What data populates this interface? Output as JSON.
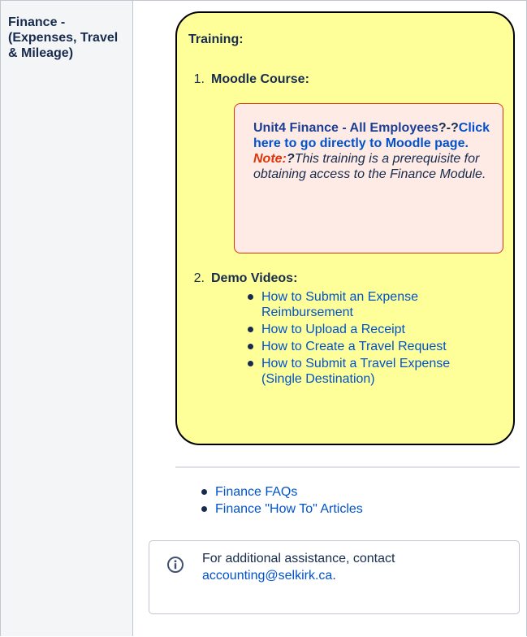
{
  "row_header": "Finance - (Expenses, Travel & Mileage)",
  "training": {
    "title": "Training:",
    "items": [
      {
        "number": "1.",
        "label": "Moodle Course:"
      },
      {
        "number": "2.",
        "label": "Demo Videos:"
      }
    ],
    "moodle": {
      "course_name": "Unit4 Finance - All Employees",
      "separator": "?-?",
      "link_text": "Click here to go directly to Moodle page.",
      "note_label": "Note:",
      "note_sep": "?",
      "note_text": "This training is a prerequisite for obtaining access to the Finance Module",
      "note_end": "."
    },
    "videos": [
      "How to Submit an Expense Reimbursement",
      "How to Upload a Receipt",
      "How to Create a Travel Request",
      "How to Submit a Travel Expense (Single Destination)"
    ]
  },
  "links": [
    "Finance FAQs",
    "Finance \"How To\" Articles"
  ],
  "info": {
    "icon": "info-icon",
    "text": "For additional assistance, contact ",
    "email": "accounting@selkirk.ca",
    "end": "."
  },
  "colors": {
    "training_bg": "#ffff99",
    "note_bg": "#ffebe6",
    "link": "#0052cc",
    "note_red": "#de350b"
  }
}
